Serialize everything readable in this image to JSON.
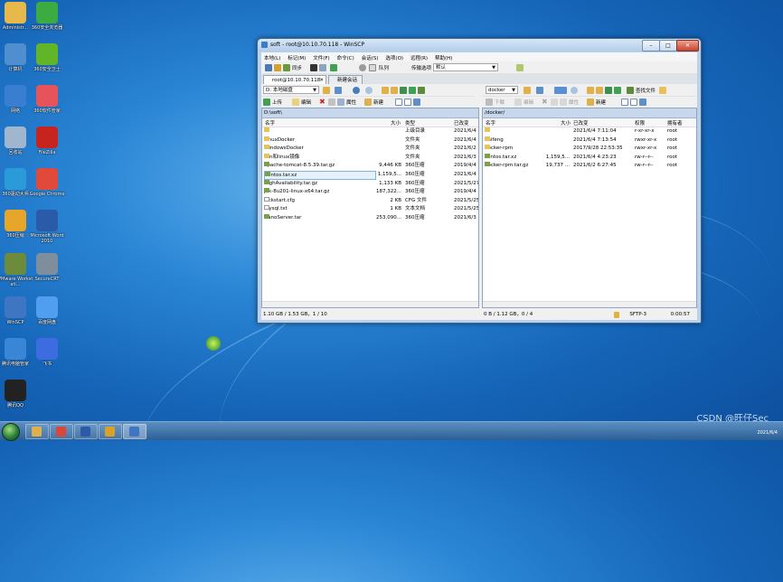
{
  "desktop": {
    "icons": [
      {
        "label": "Administr...",
        "color": "#e7b84a"
      },
      {
        "label": "360安全浏览器",
        "color": "#3cab42"
      },
      {
        "label": "计算机",
        "color": "#4f8fd0"
      },
      {
        "label": "360安全卫士",
        "color": "#63b528"
      },
      {
        "label": "网络",
        "color": "#3a7ed2"
      },
      {
        "label": "360软件管家",
        "color": "#e6535b"
      },
      {
        "label": "回收站",
        "color": "#9fb6ce"
      },
      {
        "label": "FileZilla",
        "color": "#c8241f"
      },
      {
        "label": "360驱动大师",
        "color": "#2a9bd8"
      },
      {
        "label": "Google Chrome",
        "color": "#e1493b"
      },
      {
        "label": "360压缩",
        "color": "#e5a62a"
      },
      {
        "label": "Microsoft Word 2010",
        "color": "#2b5aa8"
      },
      {
        "label": "VMware Workstati...",
        "color": "#6c8c3c"
      },
      {
        "label": "SecureCRT",
        "color": "#7e8e9c"
      },
      {
        "label": "WinSCP",
        "color": "#3e76c3"
      },
      {
        "label": "百度网盘",
        "color": "#4f9ef0"
      },
      {
        "label": "腾讯电脑管家",
        "color": "#3a86d6"
      },
      {
        "label": "飞书",
        "color": "#3d6ce0"
      },
      {
        "label": "腾讯QQ",
        "color": "#222222"
      }
    ]
  },
  "window": {
    "title": "soft - root@10.10.70.118 - WinSCP",
    "menu": [
      "本地(L)",
      "标记(M)",
      "文件(F)",
      "命令(C)",
      "会话(S)",
      "选项(O)",
      "远程(R)",
      "帮助(H)"
    ],
    "toolbar1": {
      "sync_label": "同步",
      "queue_label": "队列",
      "transfer_settings_label": "传输选项",
      "transfer_settings_value": "默认"
    },
    "tabs": [
      "root@10.10.70.118",
      "新建会话"
    ],
    "left": {
      "drive": "D: 本地磁盘",
      "upload_label": "上传",
      "edit_label": "编辑",
      "properties_label": "属性",
      "new_label": "新建",
      "path": "D:\\soft\\",
      "columns": [
        "名字",
        "大小",
        "类型",
        "已改变"
      ],
      "rows": [
        {
          "name": "..",
          "size": "",
          "type": "上级目录",
          "changed": "2021/6/4",
          "kind": "up"
        },
        {
          "name": "LinuxDocker",
          "size": "",
          "type": "文件夹",
          "changed": "2021/6/4",
          "kind": "folder"
        },
        {
          "name": "WindowsDocker",
          "size": "",
          "type": "文件夹",
          "changed": "2021/6/2",
          "kind": "folder"
        },
        {
          "name": "win和linux镜像",
          "size": "",
          "type": "文件夹",
          "changed": "2021/6/3",
          "kind": "folder"
        },
        {
          "name": "apache-tomcat-8.5.39.tar.gz",
          "size": "9,446 KB",
          "type": "360压缩",
          "changed": "2019/4/4",
          "kind": "archive"
        },
        {
          "name": "centos.tar.xz",
          "size": "1,159,5...",
          "type": "360压缩",
          "changed": "2021/6/4",
          "kind": "archive"
        },
        {
          "name": "HighAvailability.tar.gz",
          "size": "1,133 KB",
          "type": "360压缩",
          "changed": "2021/5/27",
          "kind": "archive"
        },
        {
          "name": "jdk-8u201-linux-x64.tar.gz",
          "size": "187,322...",
          "type": "360压缩",
          "changed": "2019/4/4",
          "kind": "archive"
        },
        {
          "name": "kickstart.cfg",
          "size": "2 KB",
          "type": "CFG 文件",
          "changed": "2021/5/25",
          "kind": "file"
        },
        {
          "name": "mysql.txt",
          "size": "1 KB",
          "type": "文本文档",
          "changed": "2021/5/25",
          "kind": "file"
        },
        {
          "name": "NanoServer.tar",
          "size": "253,090...",
          "type": "360压缩",
          "changed": "2021/6/3",
          "kind": "archive"
        }
      ],
      "selected_index": 5,
      "status": "1.10 GB / 1.53 GB，1 / 10"
    },
    "right": {
      "dir": "docker",
      "find_label": "查找文件",
      "download_label": "下载",
      "edit_label": "编辑",
      "properties_label": "属性",
      "new_label": "新建",
      "path": "/docker/",
      "columns": [
        "名字",
        "大小",
        "已改变",
        "权限",
        "拥有者"
      ],
      "rows": [
        {
          "name": "..",
          "size": "",
          "changed": "2021/6/4 7:11:04",
          "rights": "r-xr-xr-x",
          "owner": "root",
          "kind": "up"
        },
        {
          "name": "baifeng",
          "size": "",
          "changed": "2021/6/4 7:13:54",
          "rights": "rwxr-xr-x",
          "owner": "root",
          "kind": "folder"
        },
        {
          "name": "docker-rpm",
          "size": "",
          "changed": "2017/9/28 22:53:35",
          "rights": "rwxr-xr-x",
          "owner": "root",
          "kind": "folder"
        },
        {
          "name": "centos.tar.xz",
          "size": "1,159,5...",
          "changed": "2021/6/4 4:23:23",
          "rights": "rw-r--r--",
          "owner": "root",
          "kind": "archive"
        },
        {
          "name": "docker-rpm.tar.gz",
          "size": "19,737 ...",
          "changed": "2021/6/2 6:27:45",
          "rights": "rw-r--r--",
          "owner": "root",
          "kind": "archive"
        }
      ],
      "status": "0 B / 1.12 GB，0 / 4"
    },
    "statusbar": {
      "protocol": "SFTP-3",
      "timer": "0:00:57"
    }
  },
  "taskbar": {
    "items": [
      {
        "name": "explorer",
        "color": "#e0b14a"
      },
      {
        "name": "chrome",
        "color": "#d9473a"
      },
      {
        "name": "word",
        "color": "#2b5aa8"
      },
      {
        "name": "360zip",
        "color": "#d9a12a"
      },
      {
        "name": "winscp",
        "color": "#3e76c3"
      }
    ],
    "clock_date": "2021/6/4"
  },
  "watermark": "CSDN @旺仔Sec"
}
